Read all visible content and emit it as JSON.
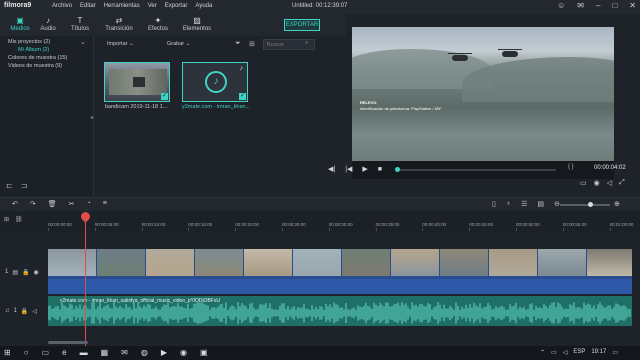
{
  "app": {
    "logo": "filmora9",
    "menu": [
      "Archivo",
      "Editar",
      "Herramientas",
      "Ver",
      "Exportar",
      "Ayuda"
    ],
    "window_title": "Untitled:  00:12:39:07"
  },
  "tabs": [
    {
      "label": "Medios",
      "icon": "folder-icon",
      "glyph": "▣"
    },
    {
      "label": "Audio",
      "icon": "music-icon",
      "glyph": "♪"
    },
    {
      "label": "Títulos",
      "icon": "text-icon",
      "glyph": "T"
    },
    {
      "label": "Transición",
      "icon": "transition-icon",
      "glyph": "⇄"
    },
    {
      "label": "Efectos",
      "icon": "effects-icon",
      "glyph": "✦"
    },
    {
      "label": "Elementos",
      "icon": "image-icon",
      "glyph": "▨"
    }
  ],
  "export_label": "EXPORTAR",
  "sidebar": {
    "items": [
      {
        "label": "Mis proyectos (2)",
        "chevron": "⌄"
      },
      {
        "label": "Mi Álbum (2)"
      },
      {
        "label": "Colores de muestra (15)"
      },
      {
        "label": "Videos de muestra (9)"
      }
    ]
  },
  "media_toolbar": {
    "import_label": "Importar",
    "record_label": "Grabar",
    "search_placeholder": "Buscar"
  },
  "media_items": [
    {
      "label": "bandicam 2019-11-18 1..."
    },
    {
      "label": "y2mate.com - imran_khan..."
    }
  ],
  "preview": {
    "overlay_title": "RELEVO",
    "overlay_subtitle": "Identificación de plataforma: PlayStation / 60F",
    "timecode": "00:00:04:02",
    "bracket": "{ }"
  },
  "timeline": {
    "ticks": [
      "00:00:00:00",
      "00:00:05:00",
      "00:00:10:00",
      "00:00:15:00",
      "00:00:20:00",
      "00:00:25:00",
      "00:00:30:00",
      "00:00:35:00",
      "00:00:40:00",
      "00:00:45:00",
      "00:00:50:00",
      "00:00:55:00",
      "00:01:00:00"
    ],
    "video_track_number": "1",
    "audio_track_number": "1",
    "audio_clip_label": "y2mate.com - imran_khan_satisfya_official_music_video_pYlODjOBFxU"
  },
  "taskbar": {
    "language": "ESP",
    "time": "19:17"
  }
}
